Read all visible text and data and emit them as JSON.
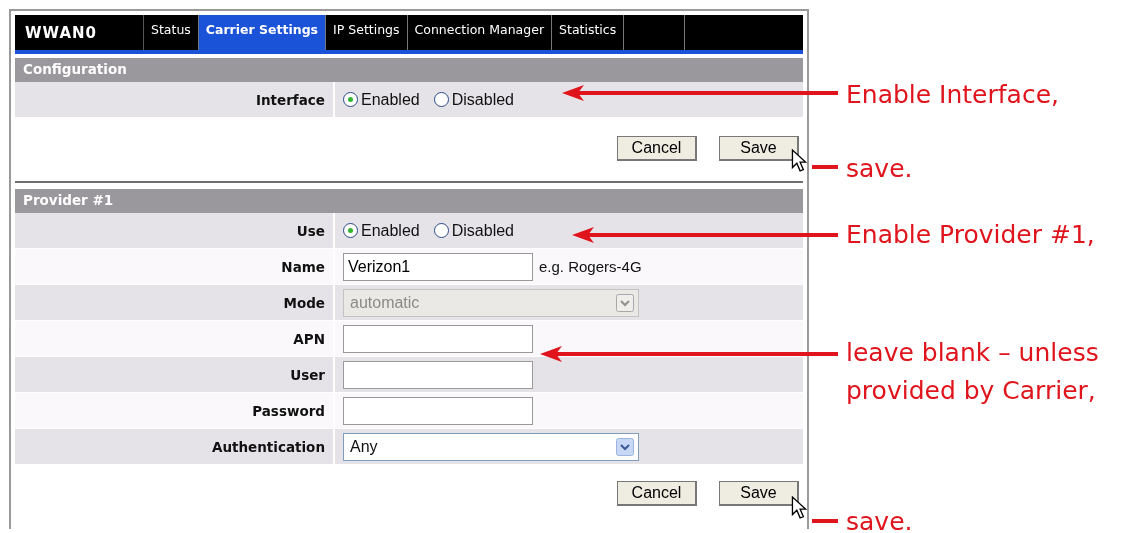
{
  "interface_name": "WWAN0",
  "tabs": [
    {
      "label": "Status",
      "selected": false
    },
    {
      "label": "Carrier Settings",
      "selected": true
    },
    {
      "label": "IP Settings",
      "selected": false
    },
    {
      "label": "Connection Manager",
      "selected": false
    },
    {
      "label": "Statistics",
      "selected": false
    }
  ],
  "sections": [
    {
      "title": "Configuration",
      "rows": [
        {
          "kind": "radio",
          "label": "Interface",
          "options": [
            {
              "label": "Enabled",
              "selected": true
            },
            {
              "label": "Disabled",
              "selected": false
            }
          ]
        }
      ],
      "buttons": [
        "Cancel",
        "Save"
      ]
    },
    {
      "title": "Provider #1",
      "rows": [
        {
          "kind": "radio",
          "label": "Use",
          "options": [
            {
              "label": "Enabled",
              "selected": true
            },
            {
              "label": "Disabled",
              "selected": false
            }
          ]
        },
        {
          "kind": "text",
          "label": "Name",
          "value": "Verizon1",
          "hint": "e.g. Rogers-4G"
        },
        {
          "kind": "select",
          "label": "Mode",
          "value": "automatic",
          "disabled": true
        },
        {
          "kind": "text",
          "label": "APN"
        },
        {
          "kind": "text",
          "label": "User"
        },
        {
          "kind": "text",
          "label": "Password"
        },
        {
          "kind": "select",
          "label": "Authentication",
          "value": "Any",
          "disabled": false
        }
      ],
      "buttons": [
        "Cancel",
        "Save"
      ]
    }
  ],
  "annotations": [
    {
      "lines": [
        "Enable Interface,"
      ]
    },
    {
      "lines": [
        "save."
      ]
    },
    {
      "lines": [
        "Enable Provider #1,"
      ]
    },
    {
      "lines": [
        "leave blank – unless",
        "provided by Carrier,"
      ]
    },
    {
      "lines": [
        "save."
      ]
    }
  ]
}
